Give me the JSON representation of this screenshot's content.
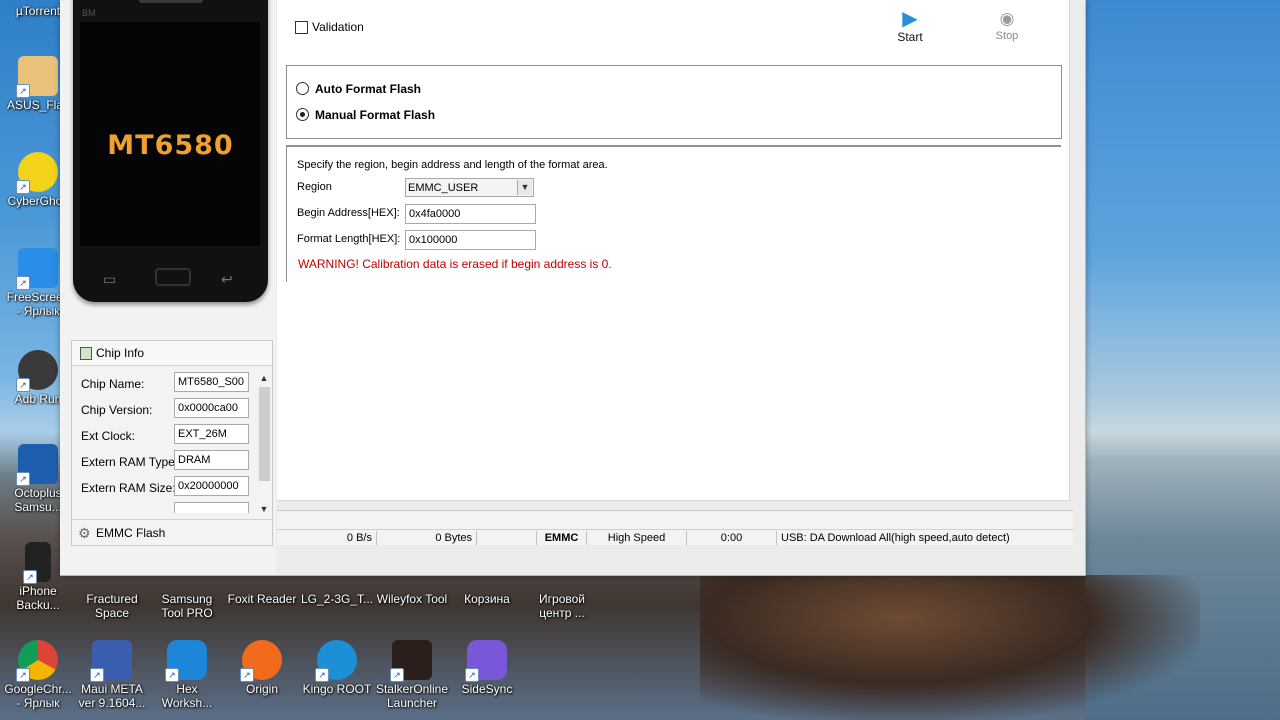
{
  "desktop": {
    "icons": [
      {
        "label": "µTorrent"
      },
      {
        "label": "ASUS_Flas"
      },
      {
        "label": "CyberGhos"
      },
      {
        "label": "FreeScreen\n- Ярлык"
      },
      {
        "label": "Adb Run"
      },
      {
        "label": "Octoplus\nSamsu..."
      },
      {
        "label": "iPhone\nBacku..."
      },
      {
        "label": "Fractured\nSpace"
      },
      {
        "label": "Samsung\nTool PRO"
      },
      {
        "label": "Foxit Reader"
      },
      {
        "label": "LG_2-3G_T..."
      },
      {
        "label": "Wileyfox Tool"
      },
      {
        "label": "Корзина"
      },
      {
        "label": "Игровой\nцентр ..."
      },
      {
        "label": "GoogleChr...\n- Ярлык"
      },
      {
        "label": "Maui META\nver 9.1604..."
      },
      {
        "label": "Hex\nWorksh..."
      },
      {
        "label": "Origin"
      },
      {
        "label": "Kingo ROOT"
      },
      {
        "label": "StalkerOnline\nLauncher"
      },
      {
        "label": "SideSync"
      }
    ]
  },
  "phone": {
    "brand": "BM",
    "chip": "MT6580"
  },
  "chip_info": {
    "title": "Chip Info",
    "rows": [
      {
        "label": "Chip Name:",
        "value": "MT6580_S00"
      },
      {
        "label": "Chip Version:",
        "value": "0x0000ca00"
      },
      {
        "label": "Ext Clock:",
        "value": "EXT_26M"
      },
      {
        "label": "Extern RAM Type:",
        "value": "DRAM"
      },
      {
        "label": "Extern RAM Size:",
        "value": "0x20000000"
      }
    ],
    "emmc_flash": "EMMC Flash"
  },
  "toolbar": {
    "validation_label": "Validation",
    "validation_checked": false,
    "start_label": "Start",
    "stop_label": "Stop"
  },
  "format": {
    "auto_label": "Auto Format Flash",
    "manual_label": "Manual Format Flash",
    "selected": "manual",
    "description": "Specify the region, begin address and length of the format area.",
    "region_label": "Region",
    "region_value": "EMMC_USER",
    "begin_label": "Begin Address[HEX]:",
    "begin_value": "0x4fa0000",
    "length_label": "Format Length[HEX]:",
    "length_value": "0x100000",
    "warning": "WARNING! Calibration data is erased if begin address is 0.",
    "warning_color": "#c00000"
  },
  "statusbar": {
    "speed": "0 B/s",
    "bytes": "0 Bytes",
    "storage": "EMMC",
    "mode": "High Speed",
    "time": "0:00",
    "usb": "USB: DA Download All(high speed,auto detect)"
  }
}
